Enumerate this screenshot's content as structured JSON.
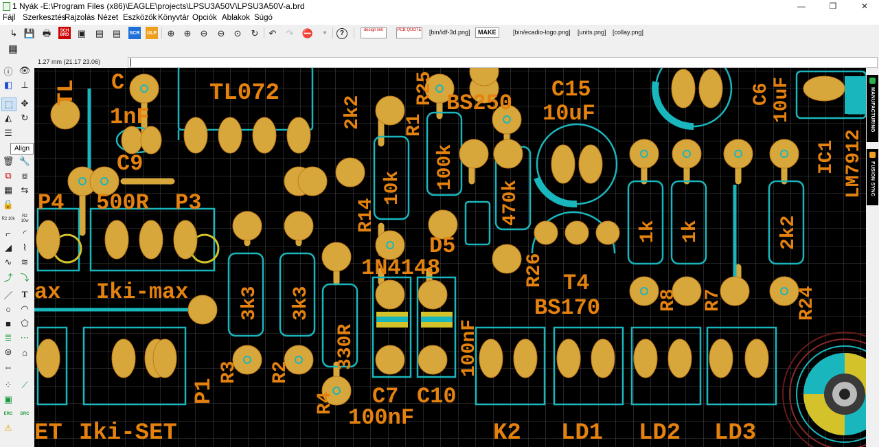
{
  "window": {
    "title": "1 Nyák -E:\\Program Files (x86)\\EAGLE\\projects\\LPSU3A50V\\LPSU3A50V-a.brd",
    "controls": {
      "minimize": "—",
      "maximize": "❐",
      "close": "✕"
    }
  },
  "menu": {
    "items": [
      "Fájl",
      "Szerkesztés",
      "Rajzolás",
      "Nézet",
      "Eszközök",
      "Könyvtár",
      "Opciók",
      "Ablakok",
      "Súgó"
    ]
  },
  "toolbar": {
    "icons": {
      "open": "↳",
      "save": "💾",
      "print": "🖶",
      "sch_brd": "SCH BRD",
      "cam": "▣",
      "chart": "▤",
      "scr": "SCR",
      "ulp": "ULP",
      "zoom_fit": "⊕",
      "zoom_in": "⊕",
      "zoom_out": "⊖",
      "zoom_sel": "⊙",
      "redraw": "↻",
      "undo": "↶",
      "redo": "↷",
      "stop": "⛔",
      "go": "●",
      "help": "?"
    },
    "design_link": "design link",
    "pcb_quote": "PCB QUOTE",
    "idf_3d": "[bin/idf-3d.png]",
    "make": "MAKE",
    "ecadio_logo": "[bin/ecadio-logo.png]",
    "units": "[units.png]",
    "collay": "[collay.png]"
  },
  "grid_button": "▦",
  "command": {
    "coordinates": "1.27 mm (21.17 23.06)",
    "value": ""
  },
  "left_tools": {
    "tooltip": "Align",
    "r2_10k": "R2 10k",
    "r2_10w": "R2 10w",
    "erc": "ERC",
    "drc": "DRC"
  },
  "right_panel": {
    "manufacturing": "MANUFACTURING",
    "fusion_sync": "FUSION SYNC"
  },
  "board": {
    "colors": {
      "background": "#000000",
      "silk": "#e5820f",
      "pad": "#d8a73c",
      "outline": "#19b7bd",
      "grid": "#585858"
    },
    "labels": {
      "r_tl": "TL",
      "c_top": "C",
      "tl072": "TL072",
      "c_1nf": "1nF",
      "c9": "C9",
      "p4": "P4",
      "r500": "500R",
      "p3": "P3",
      "max": "ax",
      "iki_max": "Iki-max",
      "set": "ET",
      "iki_set": "Iki-SET",
      "p1": "P1",
      "r3": "R3",
      "r3v": "3k3",
      "r2": "R2",
      "r2v": "3k3",
      "r4": "R4",
      "r330": "330R",
      "c7": "C7",
      "c10": "C10",
      "c100n": "100nF",
      "c100n2": "100nF",
      "r14": "R14",
      "r14v": "2k2",
      "r1": "R1",
      "r1v": "10k",
      "r100k": "100k",
      "r25": "R25",
      "bs250": "BS250",
      "d5": "D5",
      "d5v": "1N4148",
      "r470k": "470k",
      "r26": "R26",
      "c15": "C15",
      "c15v": "10uF",
      "t4": "T4",
      "t4v": "BS170",
      "r1k_a": "1k",
      "r1k_b": "1k",
      "r8": "R8",
      "r7": "R7",
      "r2k2": "2k2",
      "r24": "R24",
      "c6": "C6",
      "c6v": "10uF",
      "ic1": "IC1",
      "lm7912": "LM7912",
      "k2": "K2",
      "ld1": "LD1",
      "ld2": "LD2",
      "ld3": "LD3"
    }
  }
}
